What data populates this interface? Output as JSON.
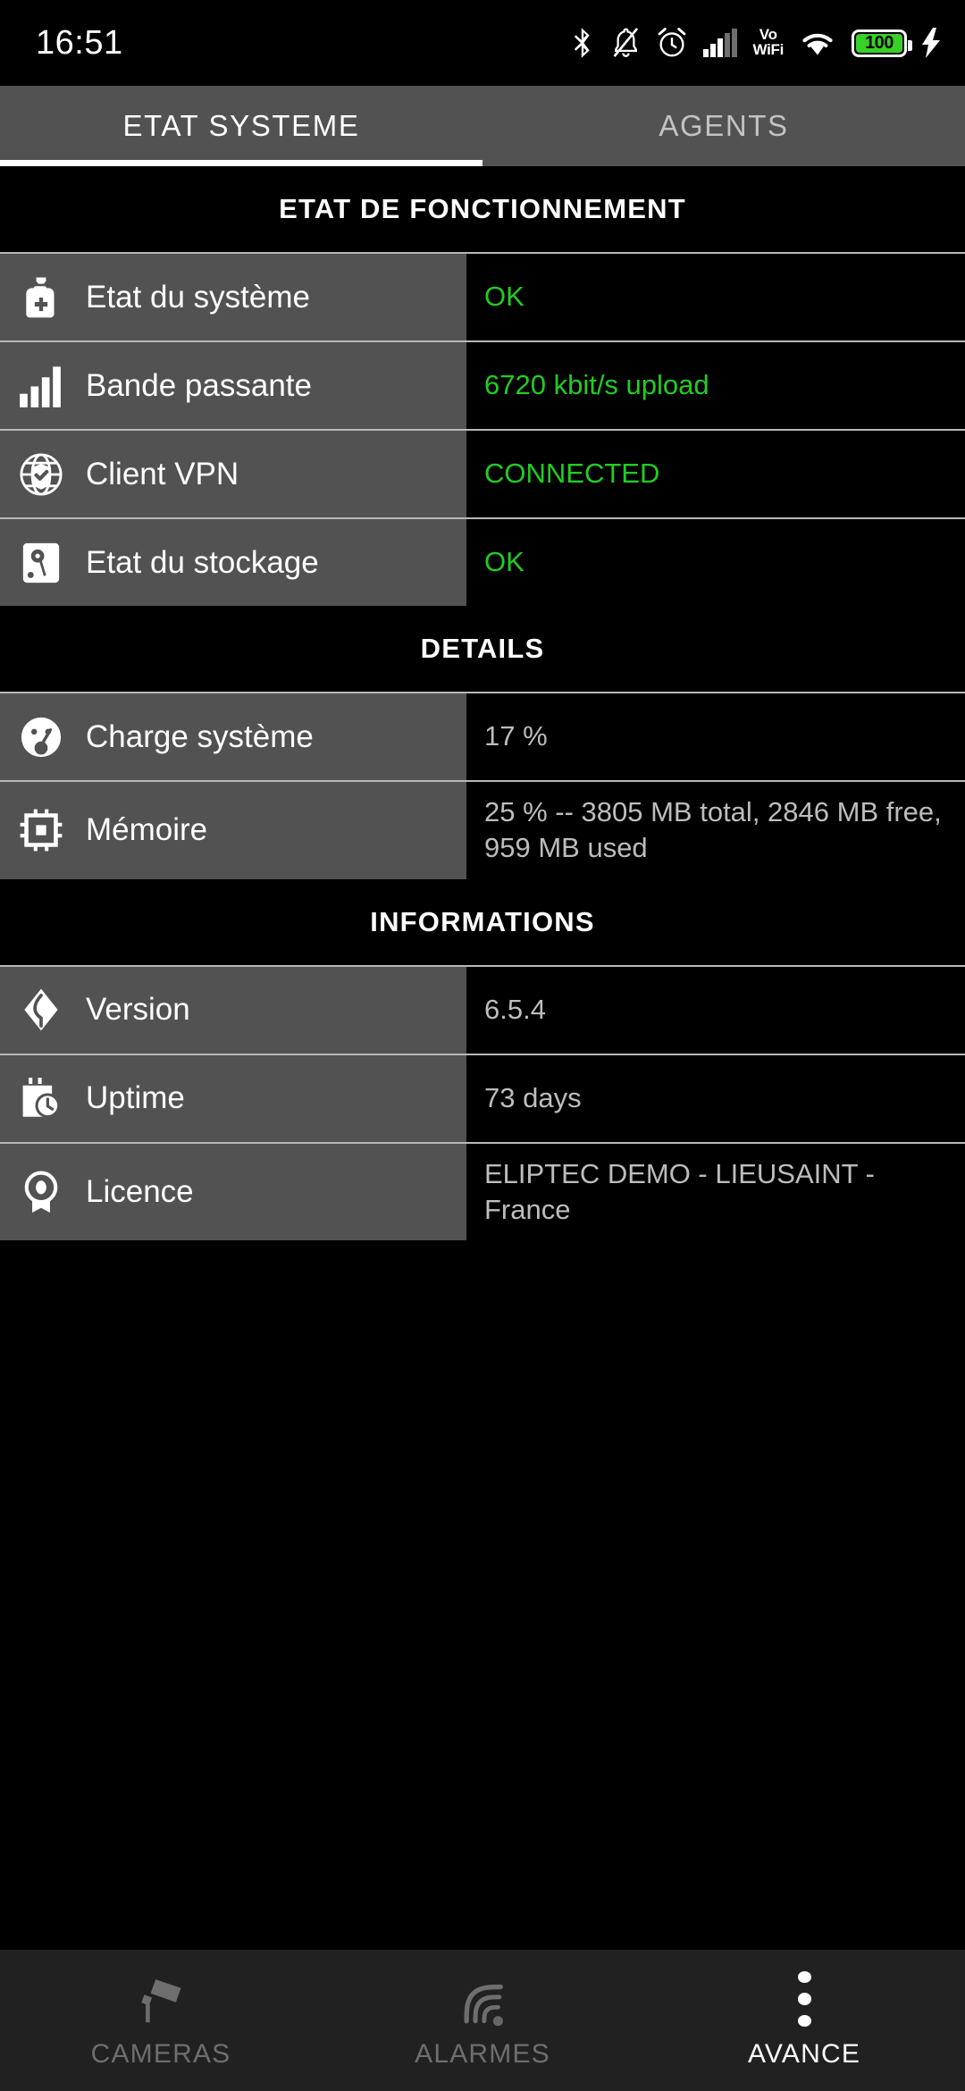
{
  "statusbar": {
    "time": "16:51",
    "icons": [
      "bluetooth-icon",
      "bell-muted-icon",
      "alarm-clock-icon",
      "cellular-signal-icon",
      "vowifi-icon",
      "wifi-icon",
      "battery-icon",
      "charging-bolt-icon"
    ],
    "vowifi_top": "Vo",
    "vowifi_bottom": "WiFi",
    "battery_level": "100"
  },
  "tabs": [
    {
      "label": "ETAT SYSTEME",
      "active": true
    },
    {
      "label": "AGENTS",
      "active": false
    }
  ],
  "colors": {
    "ok_green": "#22cc22",
    "label_bg": "#525252",
    "value_text": "#bdbdbd",
    "nav_bg": "#212121"
  },
  "sections": [
    {
      "title": "ETAT DE FONCTIONNEMENT",
      "rows": [
        {
          "icon": "medicine-bottle-icon",
          "label": "Etat du système",
          "value": "OK",
          "ok": true
        },
        {
          "icon": "signal-bars-icon",
          "label": "Bande passante",
          "value": "6720 kbit/s upload",
          "ok": true
        },
        {
          "icon": "globe-shield-icon",
          "label": "Client VPN",
          "value": "CONNECTED",
          "ok": true
        },
        {
          "icon": "hard-drive-icon",
          "label": "Etat du stockage",
          "value": "OK",
          "ok": true
        }
      ]
    },
    {
      "title": "DETAILS",
      "rows": [
        {
          "icon": "gauge-icon",
          "label": "Charge système",
          "value": "17 %",
          "ok": false
        },
        {
          "icon": "cpu-chip-icon",
          "label": "Mémoire",
          "value": "25 % -- 3805 MB total, 2846 MB free, 959 MB used",
          "ok": false
        }
      ]
    },
    {
      "title": "INFORMATIONS",
      "rows": [
        {
          "icon": "version-diamond-icon",
          "label": "Version",
          "value": "6.5.4",
          "ok": false
        },
        {
          "icon": "calendar-clock-icon",
          "label": "Uptime",
          "value": "73 days",
          "ok": false
        },
        {
          "icon": "award-badge-icon",
          "label": "Licence",
          "value": "ELIPTEC DEMO - LIEUSAINT - France",
          "ok": false
        }
      ]
    }
  ],
  "bottomnav": [
    {
      "label": "CAMERAS",
      "icon": "security-camera-icon",
      "active": false
    },
    {
      "label": "ALARMES",
      "icon": "alarm-siren-icon",
      "active": false
    },
    {
      "label": "AVANCE",
      "icon": "more-vertical-icon",
      "active": true
    }
  ]
}
